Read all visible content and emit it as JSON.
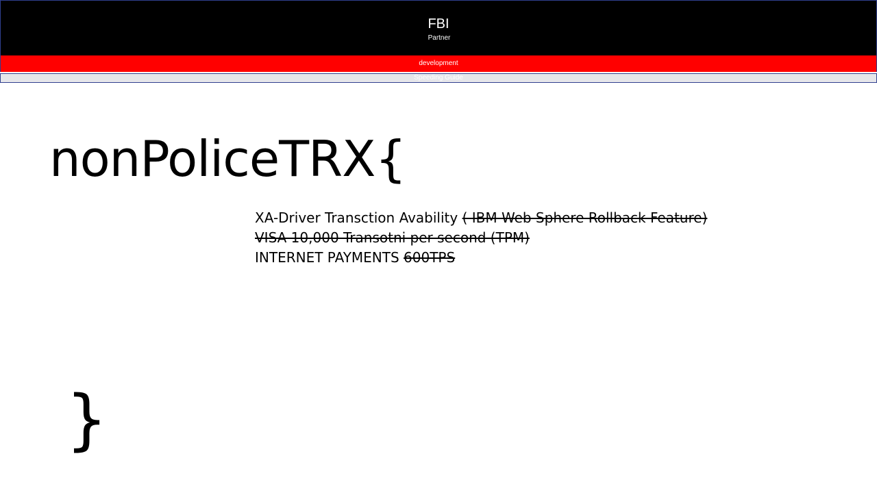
{
  "header": {
    "title": "FBI",
    "subtitle": "Partner"
  },
  "red_bar": {
    "label": "development"
  },
  "grey_bar": {
    "label": "Speeding Guide"
  },
  "main": {
    "heading": "nonPoliceTRX{",
    "closing": "}",
    "lines": [
      {
        "plain": "XA-Driver Transction Avability ",
        "struck": "( IBM Web Sphere Rollback Feature)"
      },
      {
        "plain": "",
        "struck": "VISA 10,000 Transotni per second (TPM)"
      },
      {
        "plain": "INTERNET PAYMENTS ",
        "struck": "600TPS"
      }
    ]
  },
  "colors": {
    "header_bg": "#000000",
    "red_bar": "#ff0000",
    "grey_bar": "#e6e6ea",
    "border": "#2f3f8f"
  }
}
